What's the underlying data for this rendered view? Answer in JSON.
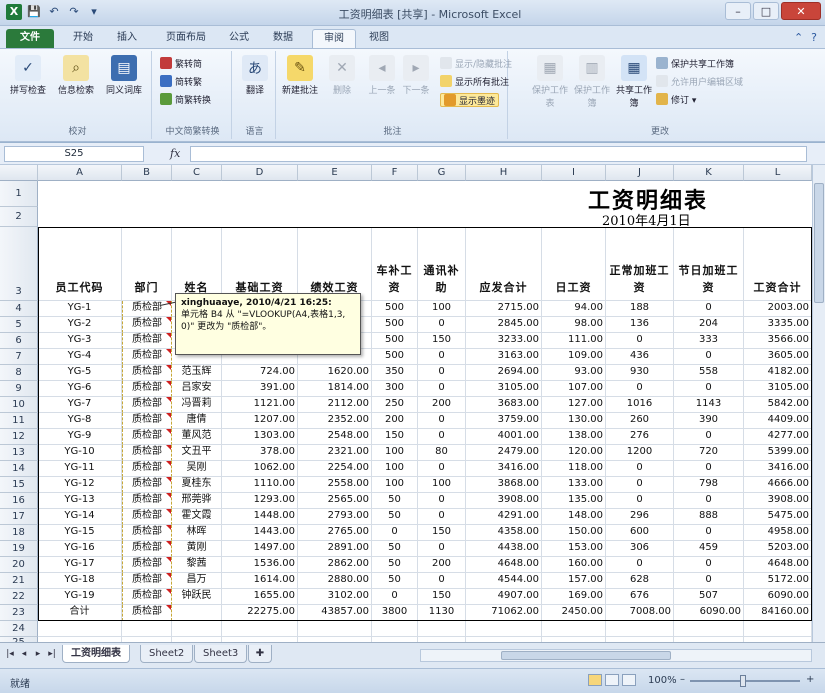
{
  "window": {
    "title": "工资明细表 [共享] - Microsoft Excel",
    "min": "–",
    "max": "□",
    "close": "✕"
  },
  "qat": {
    "save": "💾",
    "undo": "↶",
    "redo": "↷",
    "extra": "▾"
  },
  "tabs": [
    {
      "label": "文件",
      "key": "file"
    },
    {
      "label": "开始",
      "key": "home"
    },
    {
      "label": "插入",
      "key": "insert"
    },
    {
      "label": "页面布局",
      "key": "layout"
    },
    {
      "label": "公式",
      "key": "formulas"
    },
    {
      "label": "数据",
      "key": "data"
    },
    {
      "label": "审阅",
      "key": "review",
      "active": true
    },
    {
      "label": "视图",
      "key": "view"
    }
  ],
  "tab_right": {
    "help": "?",
    "min_ribbon": "⌃"
  },
  "ribbon": {
    "proofing": {
      "label": "校对",
      "spell": "拼写检查",
      "research": "信息检索",
      "thesaurus": "同义词库"
    },
    "chinese": {
      "label": "中文简繁转换",
      "to_simplified": "繁转简",
      "to_traditional": "简转繁",
      "convert": "简繁转换"
    },
    "language": {
      "label": "语言",
      "translate": "翻译"
    },
    "comments": {
      "label": "批注",
      "new": "新建批注",
      "delete": "删除",
      "prev": "上一条",
      "next": "下一条",
      "show_hide": "显示/隐藏批注",
      "show_all": "显示所有批注",
      "show_ink": "显示墨迹"
    },
    "changes": {
      "label": "更改",
      "protect_sheet": "保护工作表",
      "protect_workbook": "保护工作簿",
      "share": "共享工作簿",
      "protect_share": "保护共享工作簿",
      "allow_edit": "允许用户编辑区域",
      "track": "修订 ▾"
    }
  },
  "formula_bar": {
    "name_box": "S25",
    "fx": "fx",
    "value": ""
  },
  "columns": [
    "A",
    "B",
    "C",
    "D",
    "E",
    "F",
    "G",
    "H",
    "I",
    "J",
    "K",
    "L"
  ],
  "sheet": {
    "title": "工资明细表",
    "date": "2010年4月1日",
    "headers": [
      "员工代码",
      "部门",
      "姓名",
      "基础工资",
      "绩效工资",
      "车补工资",
      "通讯补助",
      "应发合计",
      "日工资",
      "正常加班工资",
      "节日加班工资",
      "工资合计"
    ],
    "rows": [
      [
        "YG-1",
        "质检部",
        "",
        "",
        "",
        "500",
        "100",
        "2715.00",
        "94.00",
        "188",
        "0",
        "2003.00"
      ],
      [
        "YG-2",
        "质检部",
        "",
        "",
        "",
        "500",
        "0",
        "2845.00",
        "98.00",
        "136",
        "204",
        "3335.00"
      ],
      [
        "YG-3",
        "质检部",
        "",
        "",
        "",
        "500",
        "150",
        "3233.00",
        "111.00",
        "0",
        "333",
        "3566.00"
      ],
      [
        "YG-4",
        "质检部",
        "",
        "",
        "",
        "500",
        "0",
        "3163.00",
        "109.00",
        "436",
        "0",
        "3605.00"
      ],
      [
        "YG-5",
        "质检部",
        "范玉辉",
        "724.00",
        "1620.00",
        "350",
        "0",
        "2694.00",
        "93.00",
        "930",
        "558",
        "4182.00"
      ],
      [
        "YG-6",
        "质检部",
        "吕家安",
        "391.00",
        "1814.00",
        "300",
        "0",
        "3105.00",
        "107.00",
        "0",
        "0",
        "3105.00"
      ],
      [
        "YG-7",
        "质检部",
        "冯晋莉",
        "1121.00",
        "2112.00",
        "250",
        "200",
        "3683.00",
        "127.00",
        "1016",
        "1143",
        "5842.00"
      ],
      [
        "YG-8",
        "质检部",
        "唐倩",
        "1207.00",
        "2352.00",
        "200",
        "0",
        "3759.00",
        "130.00",
        "260",
        "390",
        "4409.00"
      ],
      [
        "YG-9",
        "质检部",
        "董风范",
        "1303.00",
        "2548.00",
        "150",
        "0",
        "4001.00",
        "138.00",
        "276",
        "0",
        "4277.00"
      ],
      [
        "YG-10",
        "质检部",
        "文丑平",
        "378.00",
        "2321.00",
        "100",
        "80",
        "2479.00",
        "120.00",
        "1200",
        "720",
        "5399.00"
      ],
      [
        "YG-11",
        "质检部",
        "吴刚",
        "1062.00",
        "2254.00",
        "100",
        "0",
        "3416.00",
        "118.00",
        "0",
        "0",
        "3416.00"
      ],
      [
        "YG-12",
        "质检部",
        "夏桂东",
        "1110.00",
        "2558.00",
        "100",
        "100",
        "3868.00",
        "133.00",
        "0",
        "798",
        "4666.00"
      ],
      [
        "YG-13",
        "质检部",
        "邢莞骅",
        "1293.00",
        "2565.00",
        "50",
        "0",
        "3908.00",
        "135.00",
        "0",
        "0",
        "3908.00"
      ],
      [
        "YG-14",
        "质检部",
        "霍文霞",
        "1448.00",
        "2793.00",
        "50",
        "0",
        "4291.00",
        "148.00",
        "296",
        "888",
        "5475.00"
      ],
      [
        "YG-15",
        "质检部",
        "林晖",
        "1443.00",
        "2765.00",
        "0",
        "150",
        "4358.00",
        "150.00",
        "600",
        "0",
        "4958.00"
      ],
      [
        "YG-16",
        "质检部",
        "黄刚",
        "1497.00",
        "2891.00",
        "50",
        "0",
        "4438.00",
        "153.00",
        "306",
        "459",
        "5203.00"
      ],
      [
        "YG-17",
        "质检部",
        "黎茜",
        "1536.00",
        "2862.00",
        "50",
        "200",
        "4648.00",
        "160.00",
        "0",
        "0",
        "4648.00"
      ],
      [
        "YG-18",
        "质检部",
        "昌万",
        "1614.00",
        "2880.00",
        "50",
        "0",
        "4544.00",
        "157.00",
        "628",
        "0",
        "5172.00"
      ],
      [
        "YG-19",
        "质检部",
        "钟跃民",
        "1655.00",
        "3102.00",
        "0",
        "150",
        "4907.00",
        "169.00",
        "676",
        "507",
        "6090.00"
      ]
    ],
    "total_row": [
      "合计",
      "质检部",
      "",
      "22275.00",
      "43857.00",
      "3800",
      "1130",
      "71062.00",
      "2450.00",
      "7008.00",
      "6090.00",
      "84160.00"
    ],
    "row_numbers": [
      "1",
      "2",
      "3",
      "4",
      "5",
      "6",
      "7",
      "8",
      "9",
      "10",
      "11",
      "12",
      "13",
      "14",
      "15",
      "16",
      "17",
      "18",
      "19",
      "20",
      "21",
      "22",
      "23",
      "24",
      "25"
    ],
    "visible_row_labels": [
      "1",
      "2",
      "3",
      "4",
      "5",
      "6",
      "7",
      "8",
      "9",
      "10",
      "11",
      "12",
      "13",
      "14",
      "15",
      "16",
      "17",
      "18",
      "19",
      "20",
      "21",
      "22",
      "23",
      "24",
      "25"
    ]
  },
  "comment": {
    "author": "xinghuaaye, 2010/4/21 16:25:",
    "text": "单元格 B4 从 \"=VLOOKUP(A4,表格1,3,0)\" 更改为 \"质检部\"。"
  },
  "sheet_tabs": [
    "工资明细表",
    "Sheet2",
    "Sheet3"
  ],
  "nav": [
    "|◂",
    "◂",
    "▸",
    "▸|"
  ],
  "status": {
    "ready": "就绪",
    "zoom": "100%",
    "zoom_minus": "–",
    "zoom_plus": "+"
  },
  "colors": {
    "file_tab": "#2b7a3b",
    "comment_bg": "#ffffe1",
    "dept_border": "#c6a83a"
  }
}
